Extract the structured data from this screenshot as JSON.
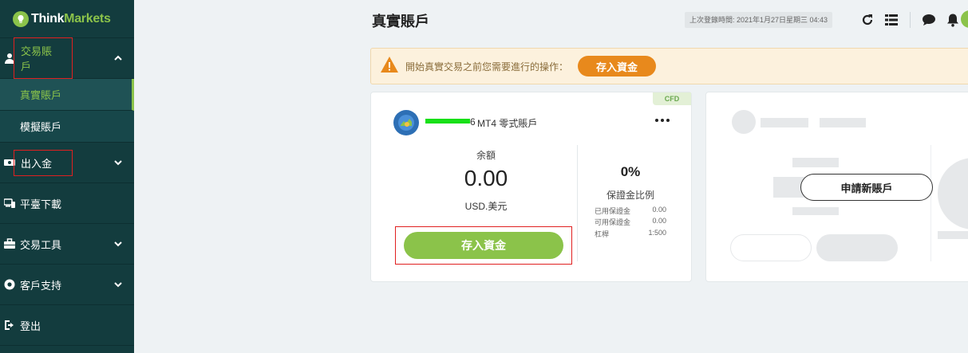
{
  "brand": {
    "name_part1": "Think",
    "name_part2": "Markets"
  },
  "sidebar": {
    "items": [
      {
        "label": "交易賬戶",
        "icon": "user-icon"
      },
      {
        "label": "出入金",
        "icon": "cash-icon"
      },
      {
        "label": "平臺下載",
        "icon": "devices-icon"
      },
      {
        "label": "交易工具",
        "icon": "toolbox-icon"
      },
      {
        "label": "客戶支持",
        "icon": "lifebuoy-icon"
      },
      {
        "label": "登出",
        "icon": "logout-icon"
      }
    ],
    "sub_items": [
      {
        "label": "真實賬戶"
      },
      {
        "label": "模擬賬戶"
      }
    ]
  },
  "header": {
    "title": "真實賬戶",
    "last_login": "上次登錄時間: 2021年1月27日星期三 04:43"
  },
  "notice": {
    "text": "開始真實交易之前您需要進行的操作：",
    "button": "存入資金"
  },
  "account_card": {
    "tag": "CFD",
    "account_number_suffix": "6",
    "account_type": "MT4 零式賬戶",
    "balance_label": "余額",
    "balance_value": "0.00",
    "currency": "USD.美元",
    "deposit_button": "存入資金",
    "margin_percent": "0%",
    "margin_label": "保證金比例",
    "margin_rows": [
      {
        "label": "已用保證金",
        "value": "0.00"
      },
      {
        "label": "可用保證金",
        "value": "0.00"
      },
      {
        "label": "杠桿",
        "value": "1:500"
      }
    ]
  },
  "new_account": {
    "button": "申請新賬戶"
  },
  "colors": {
    "sidebar_bg": "#133c3e",
    "accent_green": "#8bc34a",
    "accent_orange": "#e8891c"
  }
}
